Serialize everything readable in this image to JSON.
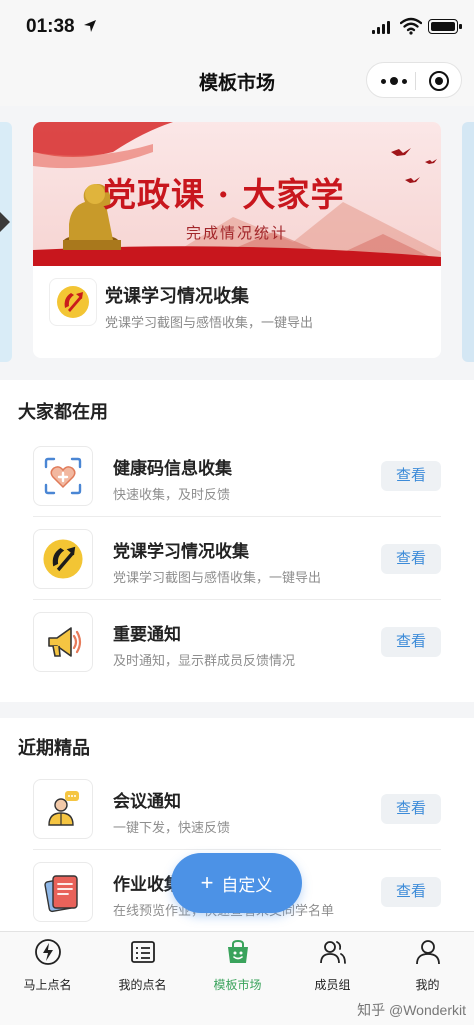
{
  "status_bar": {
    "time": "01:38"
  },
  "nav": {
    "title": "模板市场"
  },
  "banner": {
    "title": "党政课 · 大家学",
    "subtitle": "完成情况统计",
    "card_title": "党课学习情况收集",
    "card_desc": "党课学习截图与感悟收集，一键导出"
  },
  "section1": {
    "title": "大家都在用",
    "items": [
      {
        "title": "健康码信息收集",
        "desc": "快速收集，及时反馈",
        "button": "查看",
        "icon": "health-code-icon"
      },
      {
        "title": "党课学习情况收集",
        "desc": "党课学习截图与感悟收集，一键导出",
        "button": "查看",
        "icon": "party-emblem-icon"
      },
      {
        "title": "重要通知",
        "desc": "及时通知，显示群成员反馈情况",
        "button": "查看",
        "icon": "megaphone-icon"
      }
    ]
  },
  "section2": {
    "title": "近期精品",
    "items": [
      {
        "title": "会议通知",
        "desc": "一键下发，快速反馈",
        "button": "查看",
        "icon": "meeting-icon"
      },
      {
        "title": "作业收集",
        "desc": "在线预览作业，快速查看未交同学名单",
        "button": "查看",
        "icon": "homework-icon"
      }
    ]
  },
  "fab": {
    "label": "自定义",
    "plus": "+"
  },
  "tabs": [
    {
      "label": "马上点名",
      "icon": "lightning-icon"
    },
    {
      "label": "我的点名",
      "icon": "list-icon"
    },
    {
      "label": "模板市场",
      "icon": "bag-icon",
      "active": true
    },
    {
      "label": "成员组",
      "icon": "group-icon"
    },
    {
      "label": "我的",
      "icon": "person-icon"
    }
  ],
  "watermark": "知乎 @Wonderkit",
  "colors": {
    "accent": "#4c92e6",
    "active_tab": "#3aa35c",
    "button_text": "#3c8bd8",
    "banner_red": "#c8161d"
  }
}
